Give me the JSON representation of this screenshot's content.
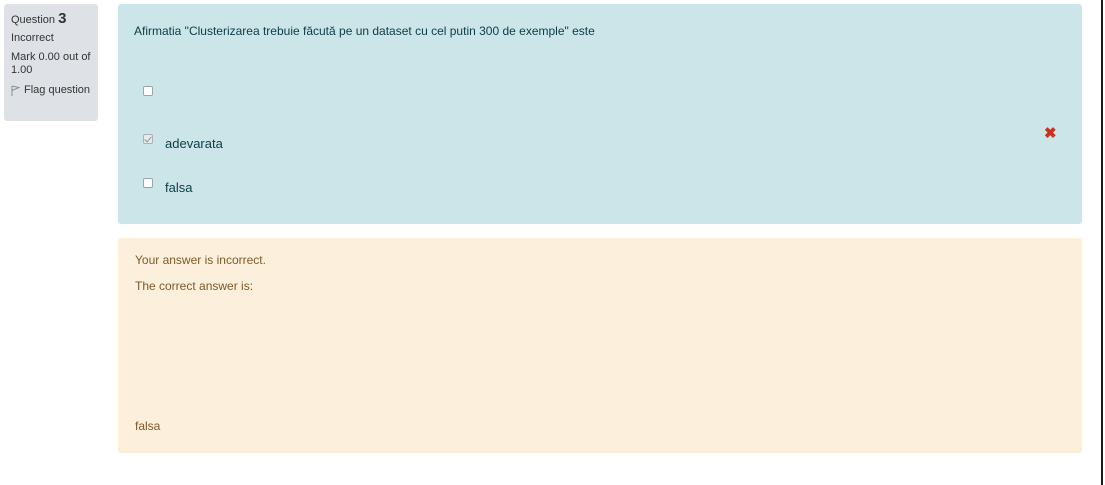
{
  "info": {
    "question_prefix": "Question",
    "question_number": "3",
    "state": "Incorrect",
    "grade": "Mark 0.00 out of 1.00",
    "flag_label": "Flag question"
  },
  "question": {
    "text": "Afirmatia \"Clusterizarea trebuie făcută pe un dataset cu cel putin 300 de exemple\" este",
    "options": [
      {
        "label": "",
        "checked": false
      },
      {
        "label": "adevarata",
        "checked": true
      },
      {
        "label": "falsa",
        "checked": false
      }
    ]
  },
  "feedback": {
    "result": "Your answer is incorrect.",
    "correct_intro": "The correct answer is:",
    "correct_answer": "falsa"
  },
  "colors": {
    "question_bg": "#cce5e9",
    "feedback_bg": "#fcefdc",
    "incorrect_mark": "#ca3120",
    "info_bg": "#dee2e6"
  }
}
